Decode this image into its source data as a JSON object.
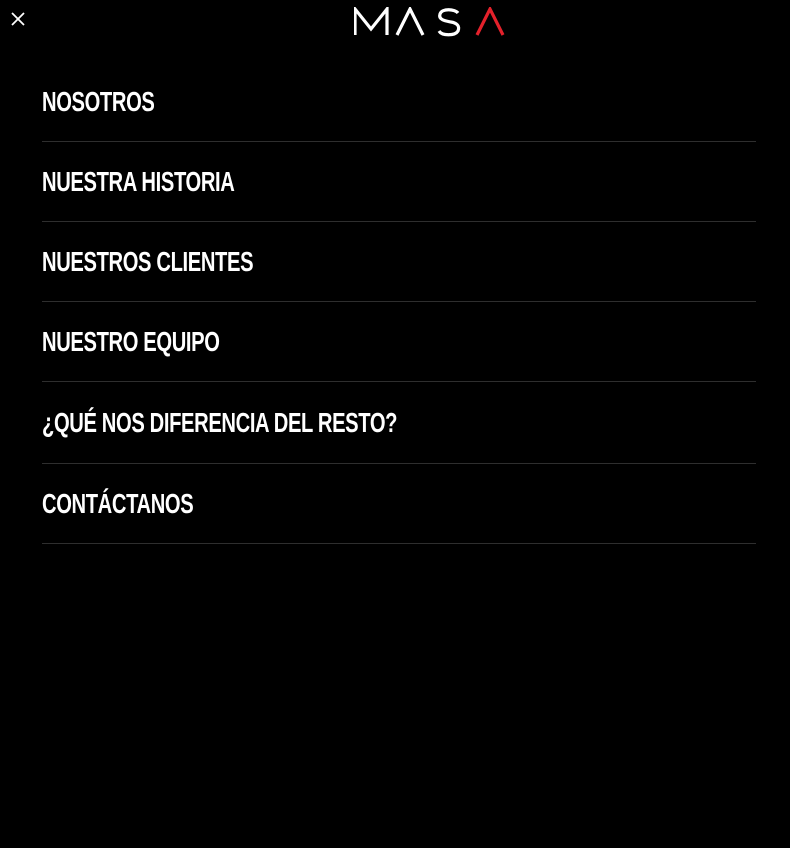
{
  "header": {
    "close_icon": "close-icon",
    "logo_text": "MASA",
    "accent_color": "#e4212b"
  },
  "menu": {
    "items": [
      {
        "label": "NOSOTROS"
      },
      {
        "label": "NUESTRA HISTORIA"
      },
      {
        "label": "NUESTROS CLIENTES"
      },
      {
        "label": "NUESTRO EQUIPO"
      },
      {
        "label": "¿QUÉ NOS DIFERENCIA DEL RESTO?"
      },
      {
        "label": "CONTÁCTANOS"
      }
    ]
  }
}
